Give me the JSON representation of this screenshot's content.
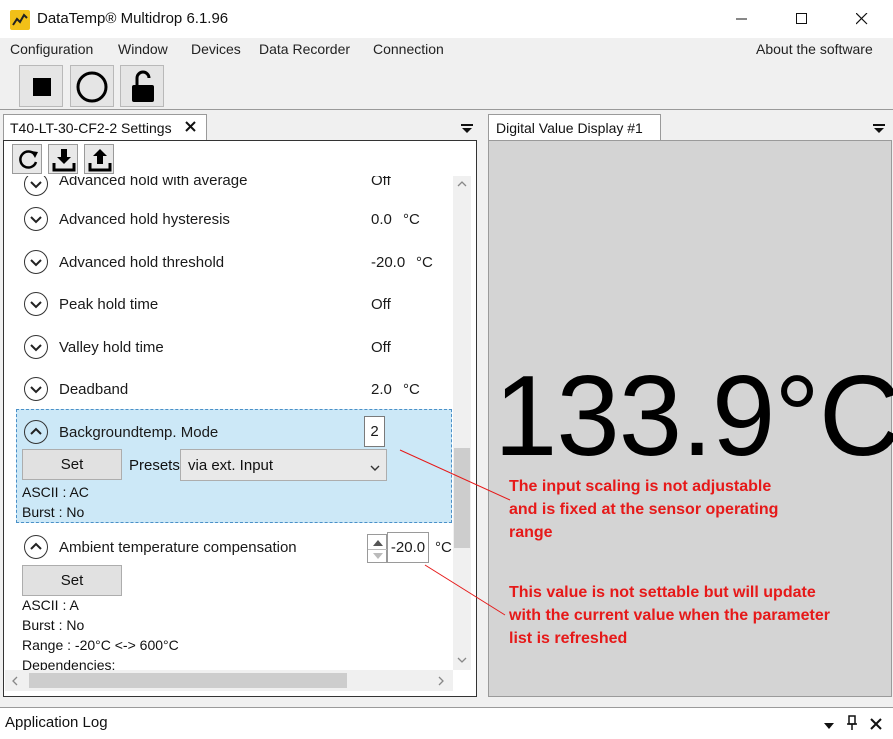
{
  "window": {
    "title": "DataTemp® Multidrop 6.1.96"
  },
  "menu": {
    "items": [
      "Configuration",
      "Window",
      "Devices",
      "Data Recorder",
      "Connection"
    ],
    "right_item": "About the software"
  },
  "toolbar": {
    "buttons": [
      "stop-icon",
      "record-icon",
      "unlock-icon"
    ]
  },
  "left_panel": {
    "tab_label": "T40-LT-30-CF2-2 Settings",
    "mini_toolbar": [
      "refresh-icon",
      "download-icon",
      "upload-icon"
    ],
    "params": [
      {
        "name": "Advanced hold with average",
        "value": "Off",
        "unit": ""
      },
      {
        "name": "Advanced hold hysteresis",
        "value": "0.0",
        "unit": "°C"
      },
      {
        "name": "Advanced hold threshold",
        "value": "-20.0",
        "unit": "°C"
      },
      {
        "name": "Peak hold time",
        "value": "Off",
        "unit": ""
      },
      {
        "name": "Valley hold time",
        "value": "Off",
        "unit": ""
      },
      {
        "name": "Deadband",
        "value": "2.0",
        "unit": "°C"
      }
    ],
    "bg_mode": {
      "name": "Backgroundtemp. Mode",
      "value": "2",
      "set_label": "Set",
      "presets_label": "Presets",
      "presets_value": "via ext. Input",
      "ascii": "ASCII : AC",
      "burst": "Burst : No"
    },
    "ambient": {
      "name": "Ambient temperature compensation",
      "value": "-20.0",
      "unit": "°C",
      "set_label": "Set",
      "ascii": "ASCII : A",
      "burst": "Burst : No",
      "range": "Range : -20°C <-> 600°C",
      "dependencies": "Dependencies:"
    }
  },
  "right_panel": {
    "tab_label": "Digital Value Display #1",
    "value": "133.9°C"
  },
  "annotations": [
    [
      "The input scaling is not adjustable",
      "and is fixed at the sensor operating",
      "range"
    ],
    [
      "This value is not settable but will update",
      "with the current value when the parameter",
      "list is refreshed"
    ]
  ],
  "log": {
    "title": "Application Log"
  },
  "colors": {
    "annotation": "#e61919",
    "selected_row": "#cce8f7",
    "display_bg": "#d4d4d4",
    "logo": "#f2c018"
  }
}
